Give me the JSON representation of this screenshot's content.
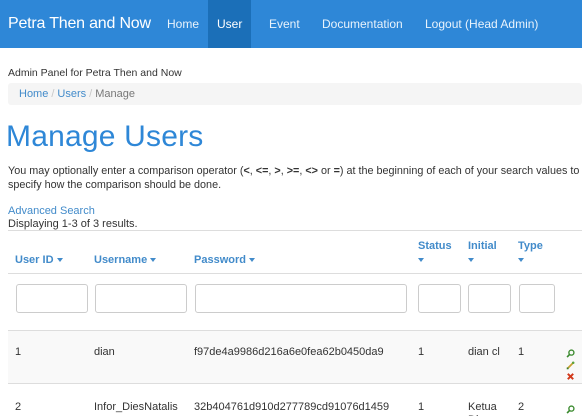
{
  "navbar": {
    "brand": "Petra Then and Now",
    "items": [
      {
        "label": "Home"
      },
      {
        "label": "User"
      },
      {
        "label": "Event"
      },
      {
        "label": "Documentation"
      },
      {
        "label": "Logout (Head Admin)"
      }
    ],
    "active_index": 1
  },
  "panel_title": "Admin Panel for Petra Then and Now",
  "breadcrumb": {
    "home": "Home",
    "users": "Users",
    "current": "Manage",
    "separator": "/"
  },
  "page": {
    "title": "Manage Users",
    "help_prefix": "You may optionally enter a comparison operator (",
    "ops": [
      "<",
      "<=",
      ">",
      ">=",
      "<>",
      "="
    ],
    "help_suffix": ") at the beginning of each of your search values to specify how the comparison should be done.",
    "or_word": "or",
    "advanced_search": "Advanced Search",
    "summary": "Displaying 1-3 of 3 results."
  },
  "table": {
    "columns": [
      {
        "label": "User ID",
        "sortable": true
      },
      {
        "label": "Username",
        "sortable": true
      },
      {
        "label": "Password",
        "sortable": true
      },
      {
        "label": "Status",
        "sortable": true
      },
      {
        "label": "Initial",
        "sortable": true
      },
      {
        "label": "Type",
        "sortable": true
      }
    ],
    "rows": [
      {
        "user_id": "1",
        "username": "dian",
        "password": "f97de4a9986d216a6e0fea62b0450da9",
        "status": "1",
        "initial": "dian cl",
        "type": "1"
      },
      {
        "user_id": "2",
        "username": "Infor_DiesNatalis",
        "password": "32b404761d910d277789cd91076d1459",
        "status": "1",
        "initial": "Ketua Dies",
        "type": "2"
      }
    ],
    "action_icons": [
      "view-icon",
      "update-icon",
      "delete-icon"
    ]
  },
  "colors": {
    "navbar": "#2e87d7",
    "navbar_active": "#1b6fb8",
    "link": "#428bca",
    "title": "#2e87d7"
  }
}
